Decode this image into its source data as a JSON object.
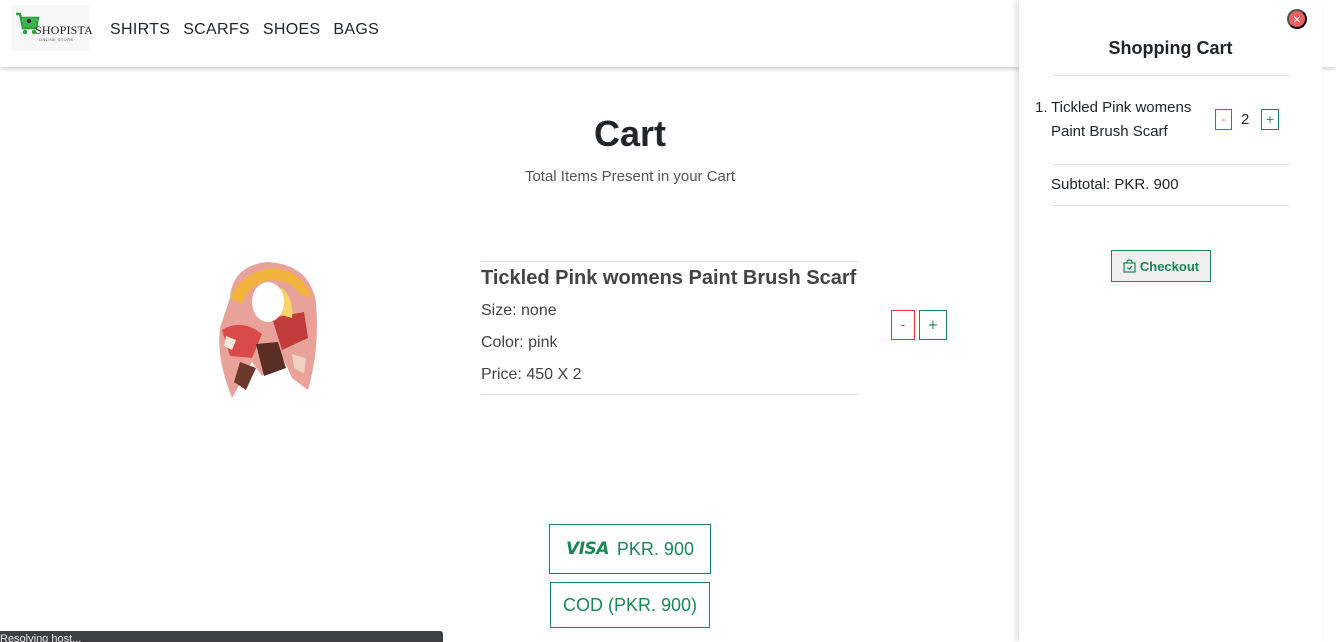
{
  "header": {
    "brand": "SHOPISTA",
    "tagline": "ONLINE STORE",
    "nav": [
      "SHIRTS",
      "SCARFS",
      "SHOES",
      "BAGS"
    ]
  },
  "main": {
    "title": "Cart",
    "subtitle": "Total Items Present in your Cart",
    "item": {
      "name": "Tickled Pink womens Paint Brush Scarf",
      "size": "Size: none",
      "color": "Color: pink",
      "price": "Price: 450 X 2",
      "minus_label": "-",
      "plus_label": "+"
    },
    "payment": {
      "visa_label": "VISA",
      "visa_amount": "PKR. 900",
      "cod_label": "COD (PKR. 900)"
    }
  },
  "status_bar": {
    "text": "Resolving host..."
  },
  "side_panel": {
    "close_label": "×",
    "title": "Shopping Cart",
    "items": [
      {
        "index": "1.",
        "name": "Tickled Pink womens Paint Brush Scarf",
        "qty": "2",
        "minus_label": "-",
        "plus_label": "+"
      }
    ],
    "subtotal": "Subtotal: PKR. 900",
    "checkout_label": "Checkout"
  },
  "colors": {
    "accent_green": "#198754",
    "danger_red": "#dc3545",
    "close_red": "#f06060"
  }
}
